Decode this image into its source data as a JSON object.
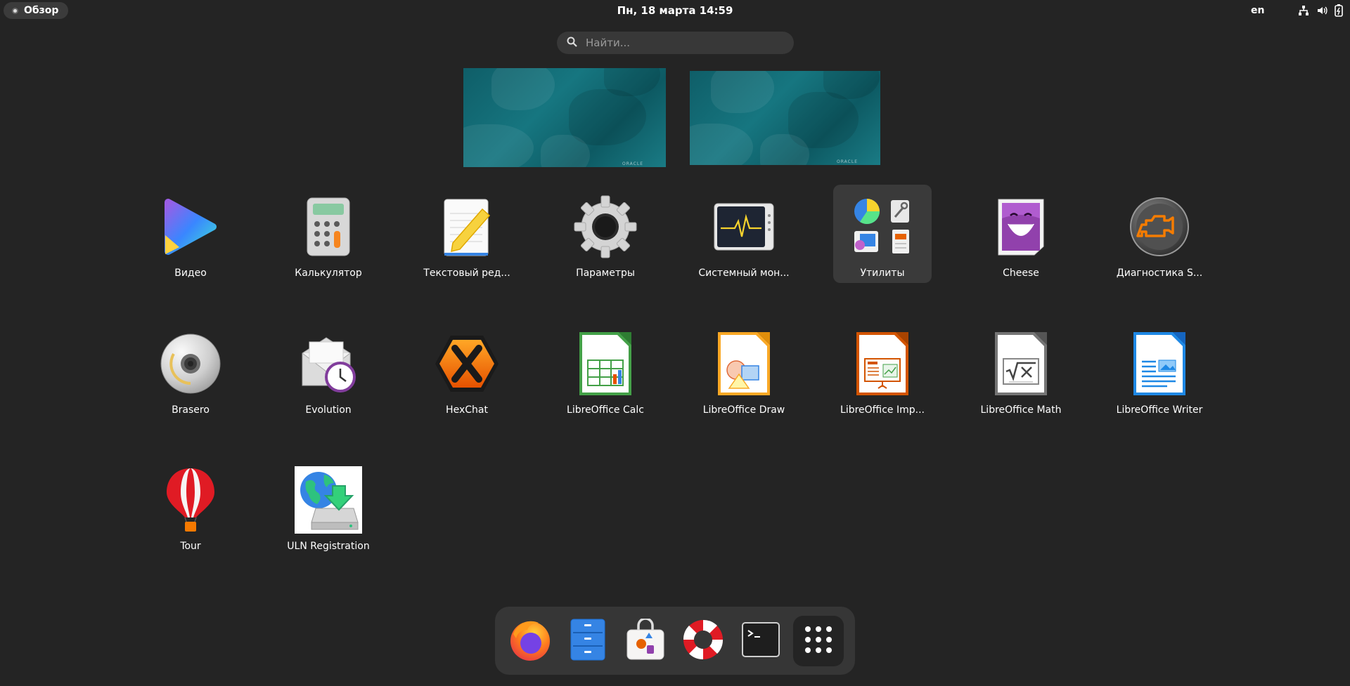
{
  "topbar": {
    "activities_label": "Обзор",
    "clock": "Пн, 18 марта  14:59",
    "keyboard_layout": "en",
    "tray_icons": [
      "network-icon",
      "volume-icon",
      "battery-icon"
    ]
  },
  "search": {
    "placeholder": "Найти..."
  },
  "workspaces": [
    {
      "label": "ORACLE"
    },
    {
      "label": "ORACLE"
    }
  ],
  "apps": [
    {
      "label": "Видео",
      "icon": "video-player-icon"
    },
    {
      "label": "Калькулятор",
      "icon": "calculator-icon"
    },
    {
      "label": "Текстовый ред...",
      "icon": "text-editor-icon"
    },
    {
      "label": "Параметры",
      "icon": "settings-icon"
    },
    {
      "label": "Системный мон...",
      "icon": "system-monitor-icon"
    },
    {
      "label": "Утилиты",
      "icon": "utilities-folder-icon",
      "selected": true
    },
    {
      "label": "Cheese",
      "icon": "cheese-icon"
    },
    {
      "label": "Диагностика S...",
      "icon": "diagnostics-icon"
    },
    {
      "label": "Brasero",
      "icon": "brasero-icon"
    },
    {
      "label": "Evolution",
      "icon": "evolution-icon"
    },
    {
      "label": "HexChat",
      "icon": "hexchat-icon"
    },
    {
      "label": "LibreOffice Calc",
      "icon": "libreoffice-calc-icon"
    },
    {
      "label": "LibreOffice Draw",
      "icon": "libreoffice-draw-icon"
    },
    {
      "label": "LibreOffice Imp...",
      "icon": "libreoffice-impress-icon"
    },
    {
      "label": "LibreOffice Math",
      "icon": "libreoffice-math-icon"
    },
    {
      "label": "LibreOffice Writer",
      "icon": "libreoffice-writer-icon"
    },
    {
      "label": "Tour",
      "icon": "tour-icon"
    },
    {
      "label": "ULN Registration",
      "icon": "uln-registration-icon"
    }
  ],
  "dash": [
    {
      "name": "firefox",
      "icon": "firefox-icon"
    },
    {
      "name": "files",
      "icon": "files-icon"
    },
    {
      "name": "software",
      "icon": "software-icon"
    },
    {
      "name": "help",
      "icon": "help-icon"
    },
    {
      "name": "terminal",
      "icon": "terminal-icon"
    },
    {
      "name": "show-apps",
      "icon": "show-apps-grid-icon"
    }
  ],
  "colors": {
    "background": "#242424",
    "selected_tile": "#3a3a3a",
    "dash_background": "#363636",
    "search_background": "#383838",
    "workspace_teal": "#167680"
  }
}
